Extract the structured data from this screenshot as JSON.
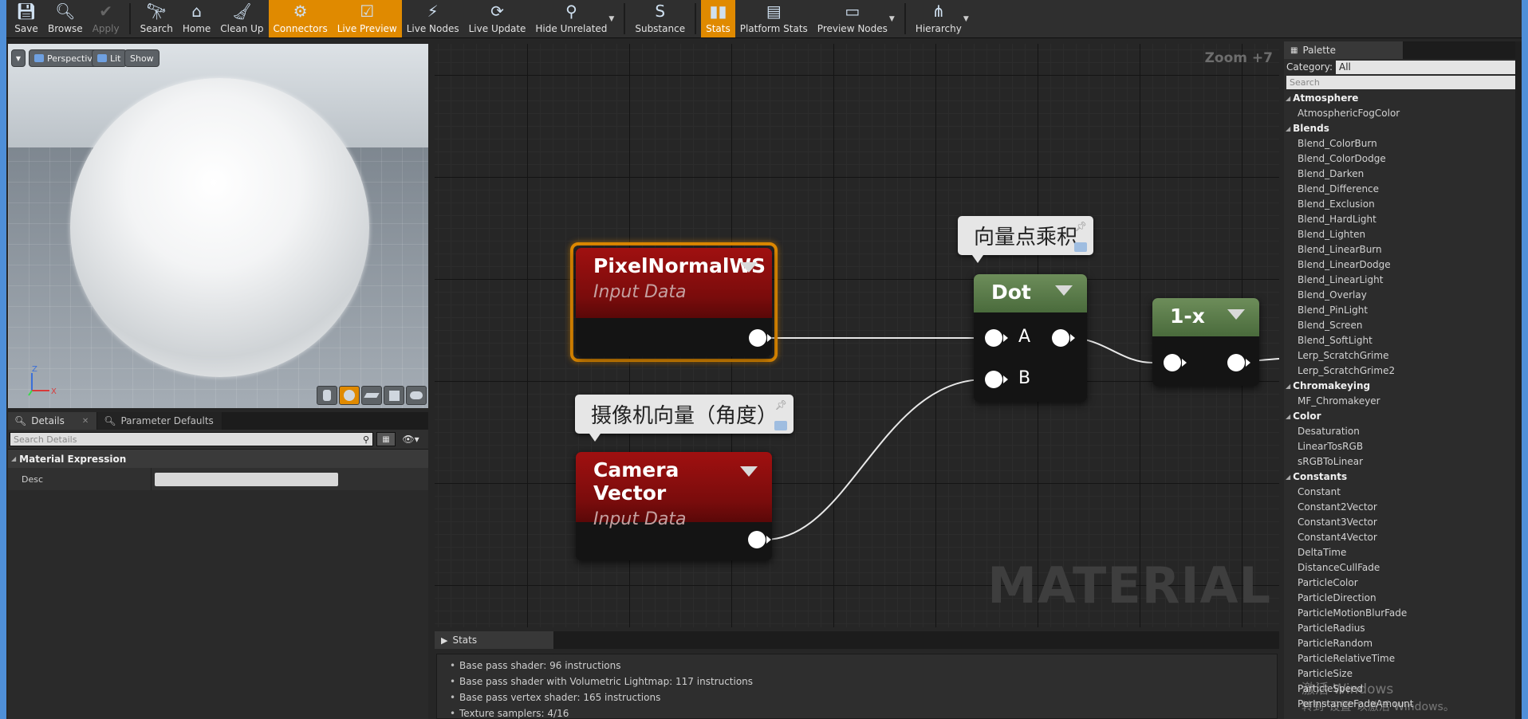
{
  "toolbar": {
    "buttons": [
      {
        "label": "Save",
        "icon": "save-icon",
        "state": "normal"
      },
      {
        "label": "Browse",
        "icon": "browse-icon",
        "state": "normal"
      },
      {
        "label": "Apply",
        "icon": "apply-icon",
        "state": "disabled"
      },
      {
        "label": "Search",
        "icon": "search-icon",
        "state": "normal"
      },
      {
        "label": "Home",
        "icon": "home-icon",
        "state": "normal"
      },
      {
        "label": "Clean Up",
        "icon": "clean-up-icon",
        "state": "normal"
      },
      {
        "label": "Connectors",
        "icon": "connectors-icon",
        "state": "active"
      },
      {
        "label": "Live Preview",
        "icon": "live-preview-icon",
        "state": "active"
      },
      {
        "label": "Live Nodes",
        "icon": "live-nodes-icon",
        "state": "normal"
      },
      {
        "label": "Live Update",
        "icon": "live-update-icon",
        "state": "normal"
      },
      {
        "label": "Hide Unrelated",
        "icon": "hide-unrelated-icon",
        "state": "normal"
      },
      {
        "label": "Substance",
        "icon": "substance-icon",
        "state": "normal"
      },
      {
        "label": "Stats",
        "icon": "stats-icon",
        "state": "active"
      },
      {
        "label": "Platform Stats",
        "icon": "platform-stats-icon",
        "state": "normal"
      },
      {
        "label": "Preview Nodes",
        "icon": "preview-nodes-icon",
        "state": "normal"
      },
      {
        "label": "Hierarchy",
        "icon": "hierarchy-icon",
        "state": "normal"
      }
    ],
    "accent": "#e08a00"
  },
  "viewport": {
    "perspective_label": "Perspective",
    "lit_label": "Lit",
    "show_label": "Show",
    "axis_z": "Z",
    "axis_x": "X"
  },
  "details": {
    "tab_details": "Details",
    "tab_params": "Parameter Defaults",
    "search_placeholder": "Search Details",
    "category": "Material Expression",
    "prop_desc": "Desc"
  },
  "graph": {
    "zoom": "Zoom +7",
    "watermark": "MATERIAL",
    "node_pixel_title": "PixelNormalWS",
    "node_pixel_sub": "Input Data",
    "node_camera_title": "Camera Vector",
    "node_camera_sub": "Input Data",
    "node_dot_title": "Dot",
    "node_oneminus_title": "1-x",
    "pin_a": "A",
    "pin_b": "B",
    "comment_dot": "向量点乘积",
    "comment_camera": "摄像机向量（角度）",
    "selection_color": "#e08a00"
  },
  "stats": {
    "tab": "Stats",
    "lines": [
      "Base pass shader: 96 instructions",
      "Base pass shader with Volumetric Lightmap: 117 instructions",
      "Base pass vertex shader: 165 instructions",
      "Texture samplers: 4/16"
    ]
  },
  "palette": {
    "tab": "Palette",
    "category_label": "Category:",
    "category_value": "All",
    "search_placeholder": "Search",
    "groups": [
      {
        "name": "Atmosphere",
        "items": [
          "AtmosphericFogColor"
        ]
      },
      {
        "name": "Blends",
        "items": [
          "Blend_ColorBurn",
          "Blend_ColorDodge",
          "Blend_Darken",
          "Blend_Difference",
          "Blend_Exclusion",
          "Blend_HardLight",
          "Blend_Lighten",
          "Blend_LinearBurn",
          "Blend_LinearDodge",
          "Blend_LinearLight",
          "Blend_Overlay",
          "Blend_PinLight",
          "Blend_Screen",
          "Blend_SoftLight",
          "Lerp_ScratchGrime",
          "Lerp_ScratchGrime2"
        ]
      },
      {
        "name": "Chromakeying",
        "items": [
          "MF_Chromakeyer"
        ]
      },
      {
        "name": "Color",
        "items": [
          "Desaturation",
          "LinearTosRGB",
          "sRGBToLinear"
        ]
      },
      {
        "name": "Constants",
        "items": [
          "Constant",
          "Constant2Vector",
          "Constant3Vector",
          "Constant4Vector",
          "DeltaTime",
          "DistanceCullFade",
          "ParticleColor",
          "ParticleDirection",
          "ParticleMotionBlurFade",
          "ParticleRadius",
          "ParticleRandom",
          "ParticleRelativeTime",
          "ParticleSize",
          "ParticleSpeed",
          "PerInstanceFadeAmount"
        ]
      }
    ]
  },
  "os_watermark": {
    "line1": "激活 Windows",
    "line2": "转到\"设置\"以激活 Windows。"
  }
}
